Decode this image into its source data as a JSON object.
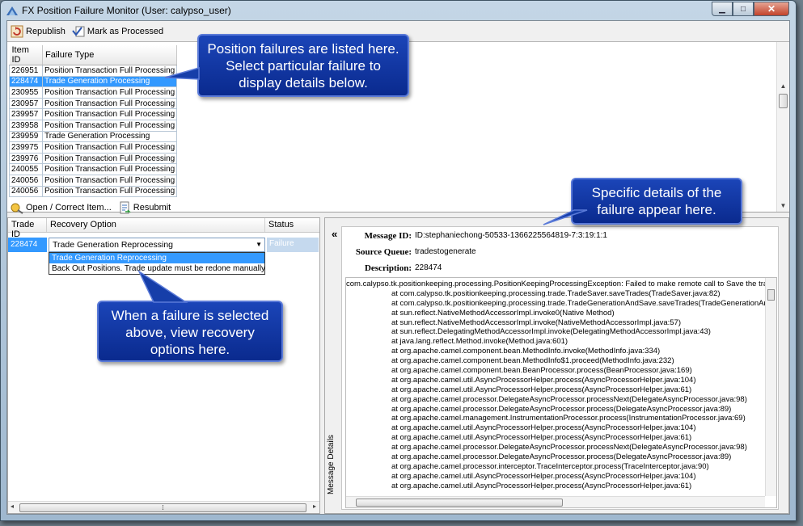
{
  "window": {
    "title": "FX Position Failure Monitor (User: calypso_user)",
    "buttons": [
      "minimize-icon",
      "maximize-icon",
      "close-icon"
    ]
  },
  "toolbar": {
    "republish_label": "Republish",
    "mark_processed_label": "Mark as Processed"
  },
  "failures": {
    "columns": [
      "Item ID",
      "Failure Type"
    ],
    "rows": [
      {
        "id": "226951",
        "type": "Position Transaction Full Processing",
        "selected": false
      },
      {
        "id": "228474",
        "type": "Trade Generation Processing",
        "selected": true
      },
      {
        "id": "230955",
        "type": "Position Transaction Full Processing",
        "selected": false
      },
      {
        "id": "230957",
        "type": "Position Transaction Full Processing",
        "selected": false
      },
      {
        "id": "239957",
        "type": "Position Transaction Full Processing",
        "selected": false
      },
      {
        "id": "239958",
        "type": "Position Transaction Full Processing",
        "selected": false
      },
      {
        "id": "239959",
        "type": "Trade Generation Processing",
        "selected": false
      },
      {
        "id": "239975",
        "type": "Position Transaction Full Processing",
        "selected": false
      },
      {
        "id": "239976",
        "type": "Position Transaction Full Processing",
        "selected": false
      },
      {
        "id": "240055",
        "type": "Position Transaction Full Processing",
        "selected": false
      },
      {
        "id": "240056",
        "type": "Position Transaction Full Processing",
        "selected": false
      },
      {
        "id": "240056",
        "type": "Position Transaction Full Processing",
        "selected": false
      }
    ]
  },
  "midtoolbar": {
    "open_label": "Open / Correct Item...",
    "resubmit_label": "Resubmit"
  },
  "recovery": {
    "columns": [
      "Trade ID",
      "Recovery Option",
      "Status"
    ],
    "trade_id": "228474",
    "selected_option": "Trade Generation Reprocessing",
    "status": "Failure",
    "options": [
      "Trade Generation Reprocessing",
      "Back Out Positions. Trade update must be redone manually"
    ]
  },
  "details": {
    "collapse_symbol": "«",
    "side_label": "Message Details",
    "message_id_label": "Message ID:",
    "message_id": "ID:stephaniechong-50533-1366225564819-7:3:19:1:1",
    "source_queue_label": "Source Queue:",
    "source_queue": "tradestogenerate",
    "description_label": "Description:",
    "description": "228474",
    "trace_first": "com.calypso.tk.positionkeeping.processing.PositionKeepingProcessingException: Failed to make remote call to Save the trad",
    "trace": [
      "at com.calypso.tk.positionkeeping.processing.trade.TradeSaver.saveTrades(TradeSaver.java:82)",
      "at com.calypso.tk.positionkeeping.processing.trade.TradeGenerationAndSave.saveTrades(TradeGenerationAn",
      "at sun.reflect.NativeMethodAccessorImpl.invoke0(Native Method)",
      "at sun.reflect.NativeMethodAccessorImpl.invoke(NativeMethodAccessorImpl.java:57)",
      "at sun.reflect.DelegatingMethodAccessorImpl.invoke(DelegatingMethodAccessorImpl.java:43)",
      "at java.lang.reflect.Method.invoke(Method.java:601)",
      "at org.apache.camel.component.bean.MethodInfo.invoke(MethodInfo.java:334)",
      "at org.apache.camel.component.bean.MethodInfo$1.proceed(MethodInfo.java:232)",
      "at org.apache.camel.component.bean.BeanProcessor.process(BeanProcessor.java:169)",
      "at org.apache.camel.util.AsyncProcessorHelper.process(AsyncProcessorHelper.java:104)",
      "at org.apache.camel.util.AsyncProcessorHelper.process(AsyncProcessorHelper.java:61)",
      "at org.apache.camel.processor.DelegateAsyncProcessor.processNext(DelegateAsyncProcessor.java:98)",
      "at org.apache.camel.processor.DelegateAsyncProcessor.process(DelegateAsyncProcessor.java:89)",
      "at org.apache.camel.management.InstrumentationProcessor.process(InstrumentationProcessor.java:69)",
      "at org.apache.camel.util.AsyncProcessorHelper.process(AsyncProcessorHelper.java:104)",
      "at org.apache.camel.util.AsyncProcessorHelper.process(AsyncProcessorHelper.java:61)",
      "at org.apache.camel.processor.DelegateAsyncProcessor.processNext(DelegateAsyncProcessor.java:98)",
      "at org.apache.camel.processor.DelegateAsyncProcessor.process(DelegateAsyncProcessor.java:89)",
      "at org.apache.camel.processor.interceptor.TraceInterceptor.process(TraceInterceptor.java:90)",
      "at org.apache.camel.util.AsyncProcessorHelper.process(AsyncProcessorHelper.java:104)",
      "at org.apache.camel.util.AsyncProcessorHelper.process(AsyncProcessorHelper.java:61)"
    ]
  },
  "callouts": {
    "list": "Position failures are listed here. Select particular failure to display details below.",
    "details": "Specific details of the failure appear here.",
    "recovery": "When a failure is selected above, view recovery options here."
  },
  "colors": {
    "selection": "#3399ff",
    "callout": "#1b45b8"
  }
}
